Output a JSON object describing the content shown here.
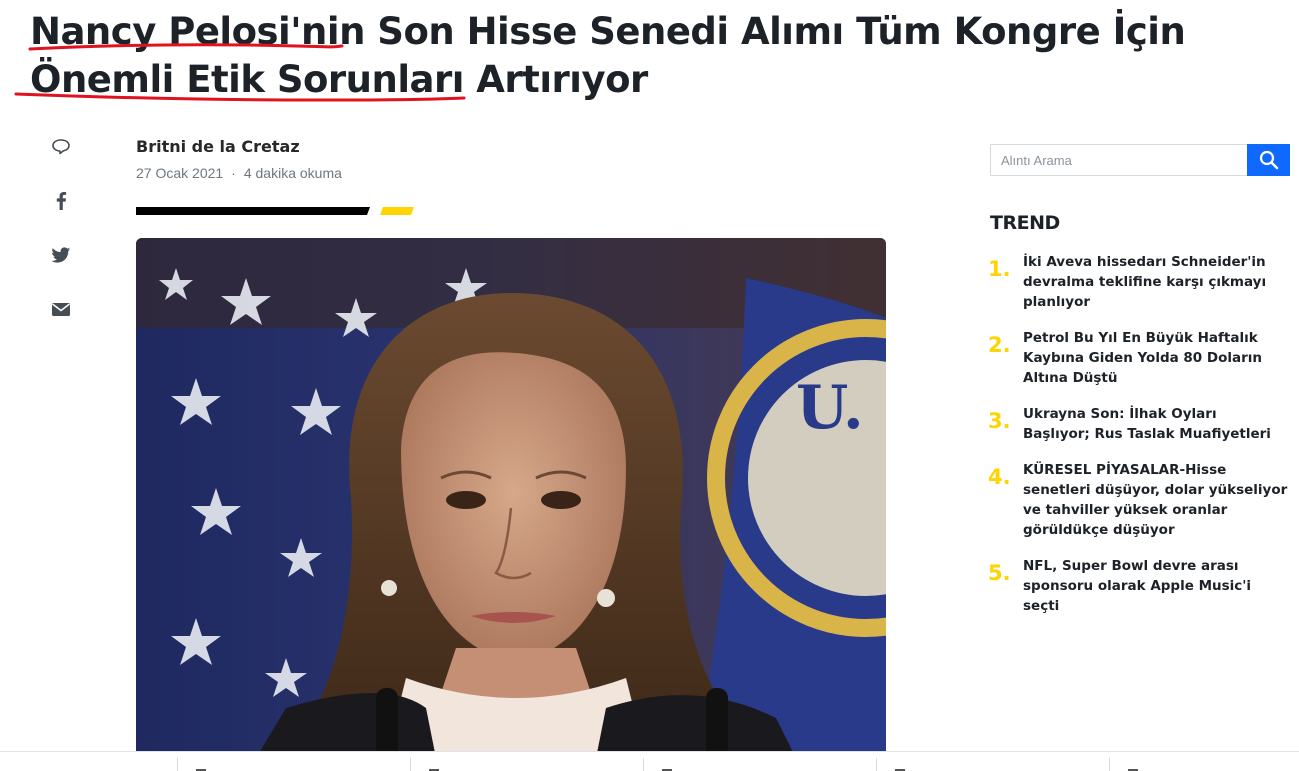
{
  "article": {
    "headline": "Nancy Pelosi'nin Son Hisse Senedi Alımı Tüm Kongre İçin Önemli Etik Sorunları Artırıyor",
    "author": "Britni de la Cretaz",
    "date": "27 Ocak 2021",
    "read_time": "4 dakika okuma",
    "separator": "·"
  },
  "share": {
    "icons": [
      "comment-icon",
      "facebook-icon",
      "twitter-icon",
      "mail-icon"
    ]
  },
  "search": {
    "placeholder": "Alıntı Arama",
    "button_icon": "search-icon"
  },
  "trending": {
    "title": "TREND",
    "items": [
      {
        "num": "1.",
        "text": "İki Aveva hissedarı Schneider'in devralma teklifine karşı çıkmayı planlıyor"
      },
      {
        "num": "2.",
        "text": "Petrol Bu Yıl En Büyük Haftalık Kaybına Giden Yolda 80 Doların Altına Düştü"
      },
      {
        "num": "3.",
        "text": "Ukrayna Son: İlhak Oyları Başlıyor; Rus Taslak Muafiyetleri"
      },
      {
        "num": "4.",
        "text": "KÜRESEL PİYASALAR-Hisse senetleri düşüyor, dolar yükseliyor ve tahviller yüksek oranlar görüldükçe düşüyor"
      },
      {
        "num": "5.",
        "text": "NFL, Super Bowl devre arası sponsoru olarak Apple Music'i seçti"
      }
    ]
  },
  "colors": {
    "accent_yellow": "#ffd400",
    "annotation_red": "#e0121e",
    "search_blue": "#0f69ff"
  }
}
